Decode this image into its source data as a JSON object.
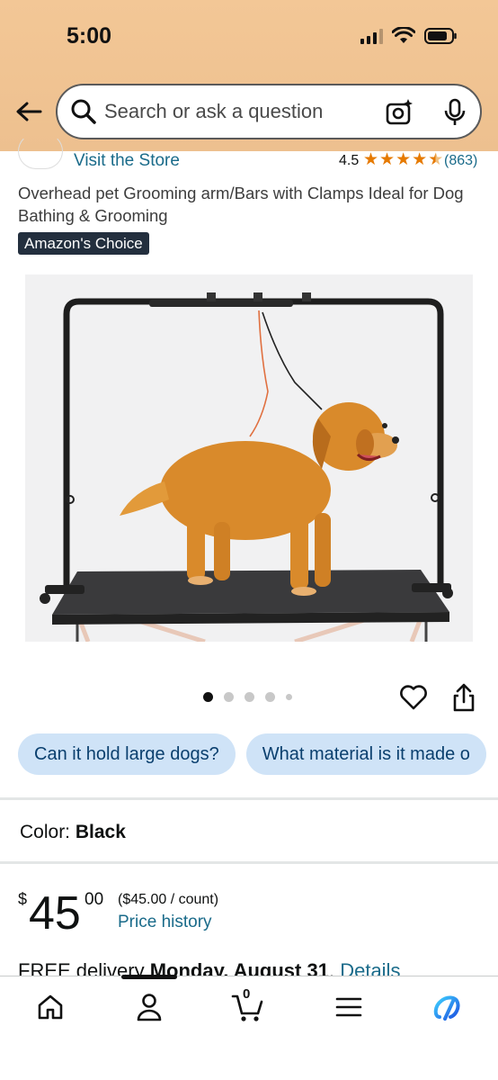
{
  "status_bar": {
    "time": "5:00"
  },
  "search": {
    "placeholder": "Search or ask a question"
  },
  "store": {
    "link_text": "Visit the Store",
    "rating": "4.5",
    "rating_count": "(863)"
  },
  "product": {
    "title": "Overhead pet Grooming arm/Bars with Clamps Ideal for Dog Bathing & Grooming",
    "badge": "Amazon's Choice",
    "image_count": 5,
    "active_image": 1
  },
  "questions": [
    {
      "label": "Can it hold large dogs?"
    },
    {
      "label": "What material is it made o"
    }
  ],
  "color": {
    "label": "Color:",
    "value": "Black"
  },
  "price": {
    "symbol": "$",
    "whole": "45",
    "fraction": "00",
    "unit": "($45.00 / count)",
    "history_link": "Price history"
  },
  "delivery": {
    "prefix": "FREE delivery ",
    "date": "Monday, August 31",
    "sep": ". ",
    "details": "Details"
  },
  "tabbar": {
    "cart_count": "0"
  },
  "colors": {
    "header": "#f0c593",
    "link": "#1a6b8a",
    "star": "#e67a00",
    "chip_bg": "#cfe3f7",
    "badge_bg": "#232f3e"
  }
}
